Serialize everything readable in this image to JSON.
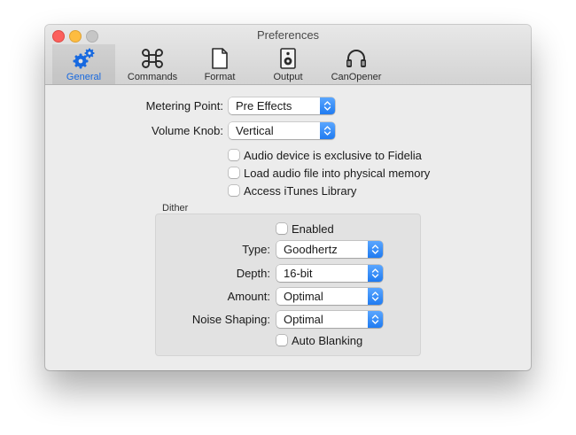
{
  "window": {
    "title": "Preferences"
  },
  "toolbar": {
    "tabs": [
      {
        "label": "General",
        "icon": "gears-icon",
        "selected": true
      },
      {
        "label": "Commands",
        "icon": "command-icon",
        "selected": false
      },
      {
        "label": "Format",
        "icon": "document-icon",
        "selected": false
      },
      {
        "label": "Output",
        "icon": "speaker-icon",
        "selected": false
      },
      {
        "label": "CanOpener",
        "icon": "headphones-icon",
        "selected": false
      }
    ]
  },
  "general": {
    "metering_point": {
      "label": "Metering Point:",
      "value": "Pre Effects"
    },
    "volume_knob": {
      "label": "Volume Knob:",
      "value": "Vertical"
    },
    "checkboxes": [
      {
        "label": "Audio device is exclusive to Fidelia",
        "checked": false
      },
      {
        "label": "Load audio file into physical memory",
        "checked": false
      },
      {
        "label": "Access iTunes Library",
        "checked": false
      }
    ]
  },
  "dither": {
    "title": "Dither",
    "enabled": {
      "label": "Enabled",
      "checked": false
    },
    "type": {
      "label": "Type:",
      "value": "Goodhertz"
    },
    "depth": {
      "label": "Depth:",
      "value": "16-bit"
    },
    "amount": {
      "label": "Amount:",
      "value": "Optimal"
    },
    "noise_shaping": {
      "label": "Noise Shaping:",
      "value": "Optimal"
    },
    "auto_blanking": {
      "label": "Auto Blanking",
      "checked": false
    }
  },
  "colors": {
    "accent": "#1f7bf1",
    "window_bg": "#ececec",
    "close": "#fc605c",
    "minimize": "#fdbc40"
  }
}
